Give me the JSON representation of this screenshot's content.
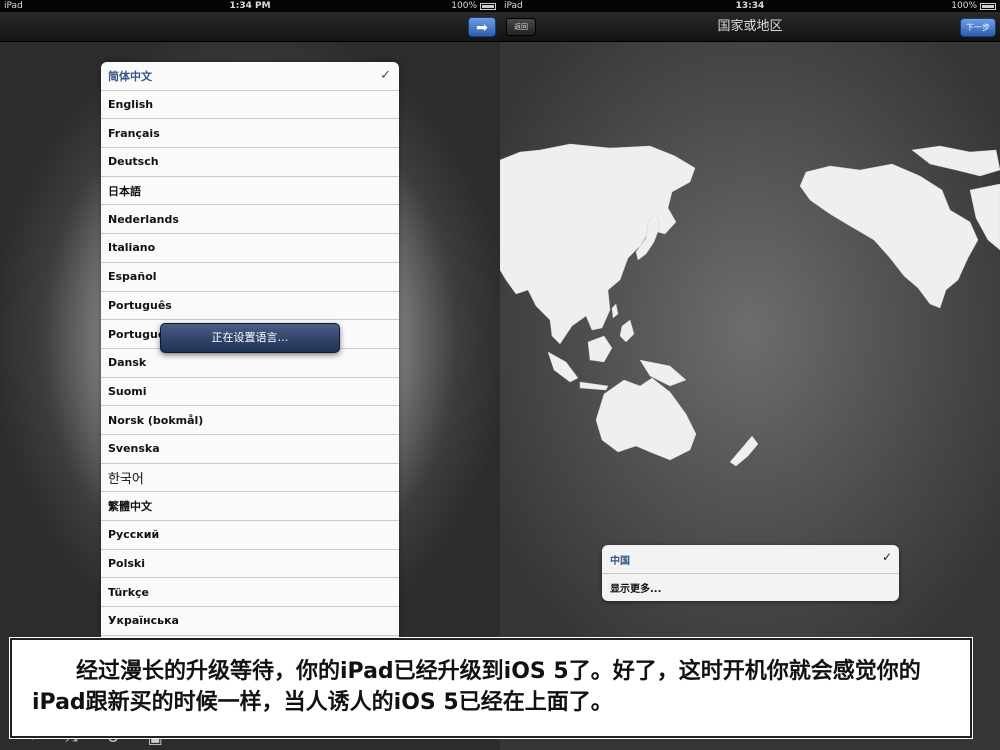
{
  "left_screen": {
    "status": {
      "carrier": "iPad",
      "time": "1:34 PM",
      "battery": "100%"
    },
    "next_button_glyph": "➡",
    "languages": [
      {
        "label": "简体中文",
        "selected": true
      },
      {
        "label": "English"
      },
      {
        "label": "Français"
      },
      {
        "label": "Deutsch"
      },
      {
        "label": "日本語"
      },
      {
        "label": "Nederlands"
      },
      {
        "label": "Italiano"
      },
      {
        "label": "Español"
      },
      {
        "label": "Português"
      },
      {
        "label": "Português (Portugal)"
      },
      {
        "label": "Dansk"
      },
      {
        "label": "Suomi"
      },
      {
        "label": "Norsk (bokmål)"
      },
      {
        "label": "Svenska"
      },
      {
        "label": "한국어"
      },
      {
        "label": "繁體中文"
      },
      {
        "label": "Русский"
      },
      {
        "label": "Polski"
      },
      {
        "label": "Türkçe"
      },
      {
        "label": "Українська"
      }
    ],
    "check_glyph": "✓",
    "toast": "正在设置语言…",
    "bottom_icons": [
      {
        "name": "add-icon",
        "glyph": "+"
      },
      {
        "name": "shuffle-icon",
        "glyph": "⤨"
      },
      {
        "name": "repeat-icon",
        "glyph": "↻"
      },
      {
        "name": "screen-icon",
        "glyph": "▣"
      }
    ]
  },
  "right_screen": {
    "status": {
      "carrier": "iPad",
      "time": "13:34",
      "battery": "100%"
    },
    "nav": {
      "back_label": "返回",
      "title": "国家或地区",
      "next_label": "下一步"
    },
    "regions": [
      {
        "label": "中国",
        "selected": true
      },
      {
        "label": "显示更多..."
      }
    ],
    "check_glyph": "✓"
  },
  "caption": "经过漫长的升级等待，你的iPad已经升级到iOS 5了。好了，这时开机你就会感觉你的iPad跟新买的时候一样，当人诱人的iOS 5已经在上面了。"
}
